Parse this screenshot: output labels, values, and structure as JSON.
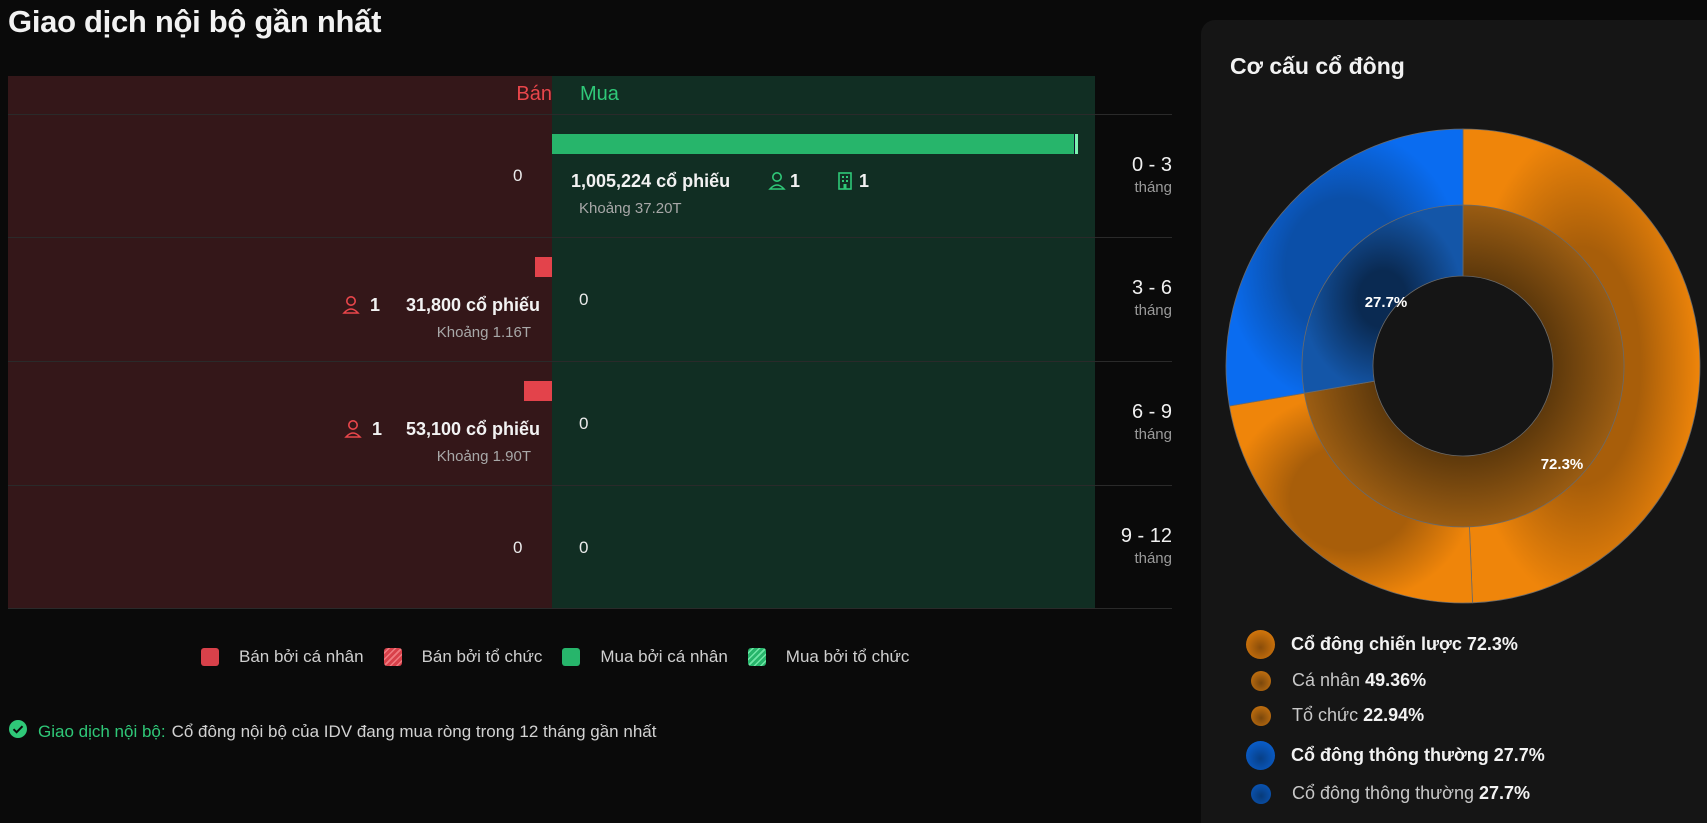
{
  "title": "Giao dịch nội bộ gần nhất",
  "headers": {
    "sell": "Bán",
    "buy": "Mua"
  },
  "rows": [
    {
      "period": "0 - 3",
      "unit": "tháng",
      "sell_value": "0",
      "buy_shares": "1,005,224 cổ phiếu",
      "buy_about": "Khoảng 37.20T",
      "buy_person_count": "1",
      "buy_org_count": "1",
      "buy_fraction": 1.0
    },
    {
      "period": "3 - 6",
      "unit": "tháng",
      "buy_value": "0",
      "sell_shares": "31,800 cổ phiếu",
      "sell_about": "Khoảng 1.16T",
      "sell_person_count": "1",
      "sell_fraction": 0.032
    },
    {
      "period": "6 - 9",
      "unit": "tháng",
      "buy_value": "0",
      "sell_shares": "53,100 cổ phiếu",
      "sell_about": "Khoảng 1.90T",
      "sell_person_count": "1",
      "sell_fraction": 0.053
    },
    {
      "period": "9 - 12",
      "unit": "tháng",
      "sell_value": "0",
      "buy_value": "0"
    }
  ],
  "legend": [
    {
      "label": "Bán bởi cá nhân",
      "color": "#d8414a",
      "pattern": "solid"
    },
    {
      "label": "Bán bởi tổ chức",
      "color": "#d8414a",
      "pattern": "hatch"
    },
    {
      "label": "Mua bởi cá nhân",
      "color": "#27b56b",
      "pattern": "solid"
    },
    {
      "label": "Mua bởi tổ chức",
      "color": "#27b56b",
      "pattern": "hatch"
    }
  ],
  "note": {
    "label": "Giao dịch nội bộ:",
    "text": "Cổ đông nội bộ của IDV đang mua ròng trong 12 tháng gần nhất"
  },
  "shareholders": {
    "title": "Cơ cấu cổ đông",
    "inner_labels": {
      "strategic": "72.3%",
      "common": "27.7%"
    },
    "legend": [
      {
        "name": "Cổ đông chiến lược 72.3%",
        "type": "main",
        "color": "#e8820c"
      },
      {
        "name": "Cá nhân",
        "value": "49.36%",
        "type": "sub",
        "color": "#c87410"
      },
      {
        "name": "Tổ chức",
        "value": "22.94%",
        "type": "sub",
        "color": "#c87410"
      },
      {
        "name": "Cổ đông thông thường 27.7%",
        "type": "main",
        "color": "#0a67e0"
      },
      {
        "name": "Cổ đông thông thường",
        "value": "27.7%",
        "type": "sub",
        "color": "#0a5bc4"
      }
    ],
    "outer": [
      {
        "name": "Cá nhân",
        "value": 49.36,
        "color": "#e8820c"
      },
      {
        "name": "Tổ chức",
        "value": 22.94,
        "color": "#e8820c"
      },
      {
        "name": "Cổ đông thông thường",
        "value": 27.7,
        "color": "#0a67e0"
      }
    ],
    "inner": [
      {
        "name": "Cổ đông chiến lược",
        "value": 72.3,
        "color": "#c87410"
      },
      {
        "name": "Cổ đông thông thường",
        "value": 27.7,
        "color": "#0a5bc4"
      }
    ]
  }
}
